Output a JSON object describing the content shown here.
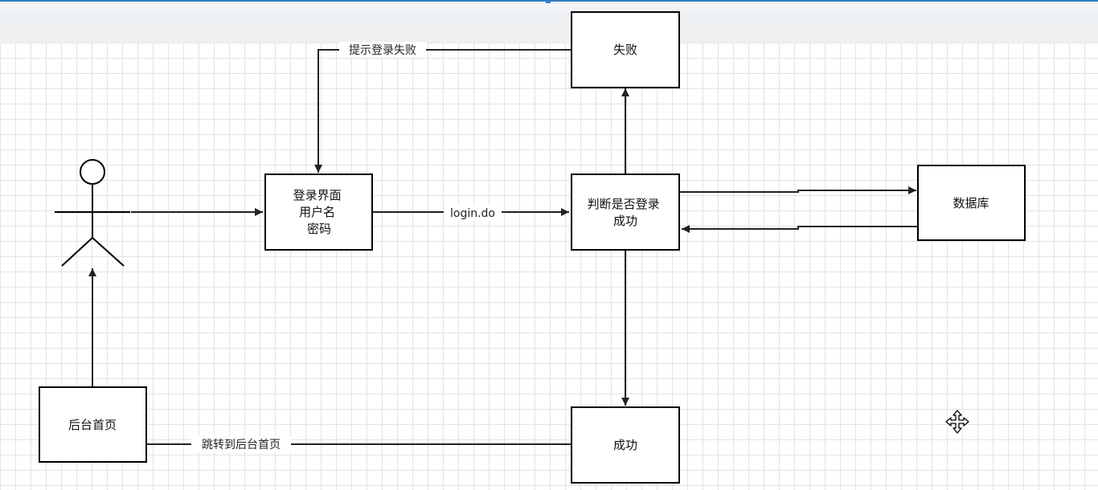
{
  "diagram": {
    "nodes": {
      "login_page": {
        "lines": [
          "登录界面",
          "用户名",
          "密码"
        ]
      },
      "judge": {
        "lines": [
          "判断是否登录",
          "成功"
        ]
      },
      "failure": {
        "label": "失败"
      },
      "database": {
        "label": "数据库"
      },
      "success": {
        "label": "成功"
      },
      "admin_home": {
        "label": "后台首页"
      }
    },
    "edges": {
      "login_do": "login.do",
      "login_failed": "提示登录失败",
      "redirect_home": "跳转到后台首页"
    }
  },
  "icons": {
    "actor": "user-actor-icon",
    "move": "move-cursor-icon"
  },
  "colors": {
    "stroke": "#000000",
    "grid": "#e3e3e3",
    "accent": "#2f7fc1"
  }
}
